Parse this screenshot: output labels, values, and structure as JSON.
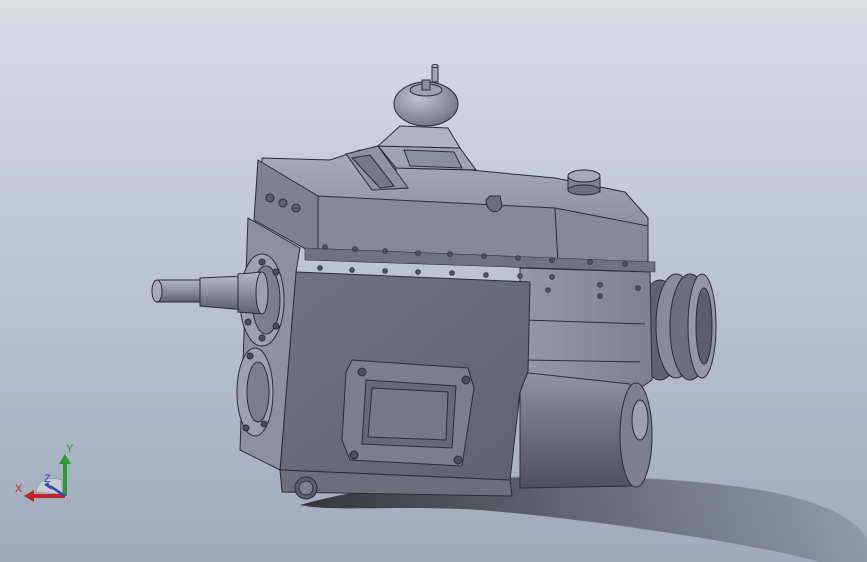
{
  "viewport": {
    "background_top": "#d8dde4",
    "background_bottom": "#9eabbb"
  },
  "model": {
    "body_color": "#767b88",
    "body_light": "#9ea2ae",
    "body_dark": "#4e5360",
    "edge_color": "#2b2e36",
    "shadow_color": "#3a3a3f"
  },
  "triad": {
    "x_label": "X",
    "y_label": "Y",
    "z_label": "Z",
    "x_color": "#c0262b",
    "y_color": "#2f9a33",
    "z_color": "#2b4bb8"
  }
}
